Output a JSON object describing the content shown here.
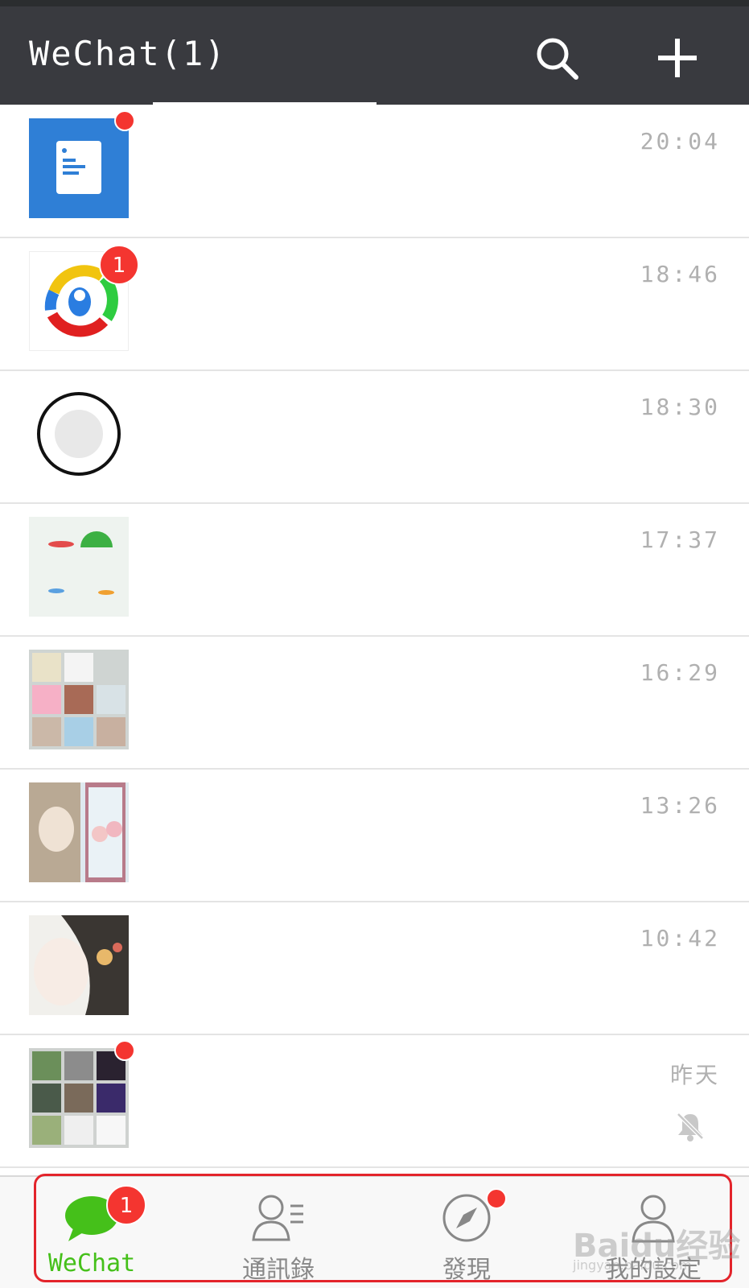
{
  "app": {
    "title": "WeChat(1)"
  },
  "chats": [
    {
      "time": "20:04",
      "badge": ""
    },
    {
      "time": "18:46",
      "badge": "1"
    },
    {
      "time": "18:30",
      "badge": ""
    },
    {
      "time": "17:37",
      "badge": ""
    },
    {
      "time": "16:29",
      "badge": ""
    },
    {
      "time": "13:26",
      "badge": ""
    },
    {
      "time": "10:42",
      "badge": ""
    },
    {
      "time": "昨天",
      "badge": ""
    }
  ],
  "bottom_nav": {
    "tabs": [
      {
        "label": "WeChat",
        "badge": "1"
      },
      {
        "label": "通訊錄"
      },
      {
        "label": "發現"
      },
      {
        "label": "我的設定"
      }
    ]
  },
  "watermark": {
    "text": "Baidu经验",
    "sub": "jingyan.baidu.com"
  },
  "colors": {
    "header_bg": "#393a3f",
    "accent_green": "#45c01a",
    "badge_red": "#f43530",
    "highlight_red": "#e3242b"
  }
}
